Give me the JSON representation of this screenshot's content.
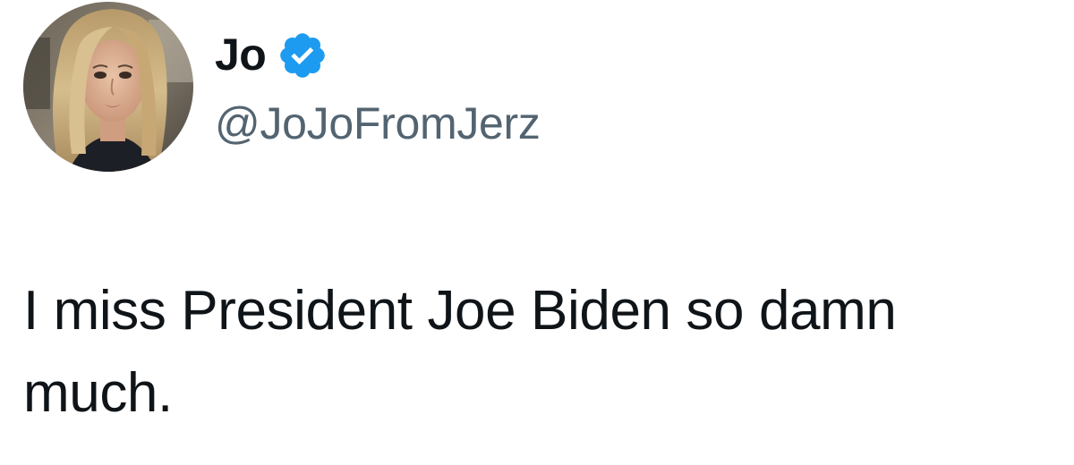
{
  "author": {
    "display_name": "Jo",
    "handle": "@JoJoFromJerz",
    "verified": true,
    "verified_icon": "verified-badge-icon",
    "avatar": "profile-photo"
  },
  "tweet": {
    "text": "I miss President Joe Biden so damn much."
  },
  "colors": {
    "text_primary": "#0f1419",
    "text_secondary": "#536471",
    "verified_blue": "#1d9bf0",
    "background": "#ffffff"
  }
}
